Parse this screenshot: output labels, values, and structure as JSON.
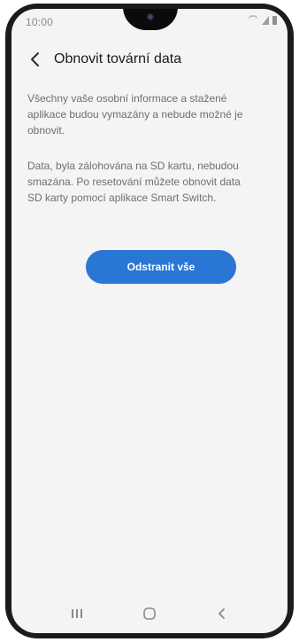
{
  "status_bar": {
    "time": "10:00",
    "icons": [
      "wifi-icon",
      "signal-icon",
      "battery-icon"
    ]
  },
  "header": {
    "back_icon": "chevron-left-icon",
    "title": "Obnovit tovární data"
  },
  "content": {
    "paragraph_1": "Všechny vaše osobní informace a stažené\naplikace budou vymazány a nebude možné je\nobnovit.",
    "paragraph_2": "Data, byla zálohována na SD kartu, nebudou\nsmazána. Po resetování můžete obnovit data\nSD karty pomocí aplikace Smart Switch."
  },
  "actions": {
    "erase_all_label": "Odstranit vše"
  },
  "navigation": {
    "recents_icon": "recents-icon",
    "home_icon": "home-icon",
    "back_icon": "back-icon"
  },
  "colors": {
    "screen_bg": "#f4f4f4",
    "button_bg": "#2a76d4",
    "text_primary": "#1c1c1c",
    "text_secondary": "#6f6f6f"
  }
}
